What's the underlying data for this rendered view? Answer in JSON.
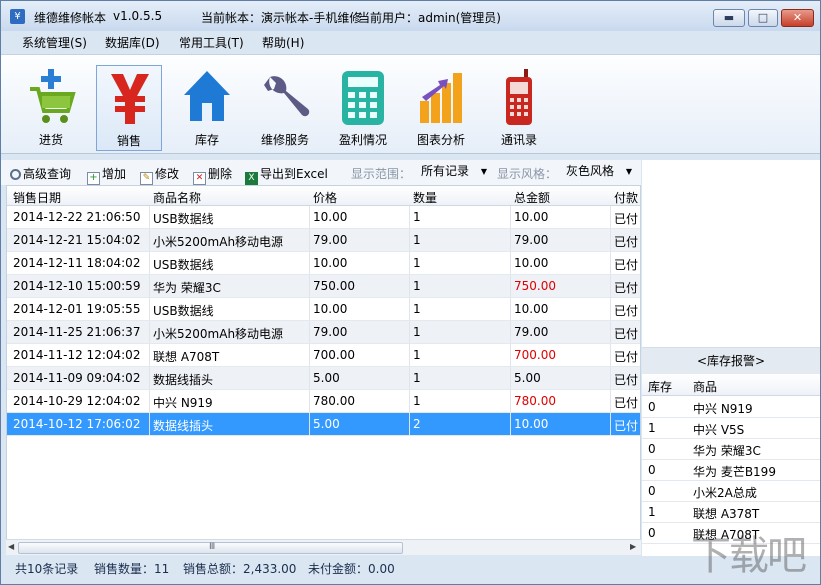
{
  "window": {
    "title": "维德维修帐本",
    "version": "v1.0.5.5",
    "account": "当前帐本：演示帐本-手机维修",
    "user": "当前用户：admin(管理员)",
    "app_icon": "¥",
    "controls": {
      "minimize": "▬",
      "maximize": "□",
      "close": "✕"
    }
  },
  "menu": [
    "系统管理(S)",
    "数据库(D)",
    "常用工具(T)",
    "帮助(H)"
  ],
  "toolbar": [
    {
      "label": "进货",
      "icon": "cart-icon",
      "active": false
    },
    {
      "label": "销售",
      "icon": "yen-icon",
      "active": true
    },
    {
      "label": "库存",
      "icon": "house-icon",
      "active": false
    },
    {
      "label": "维修服务",
      "icon": "wrench-icon",
      "active": false
    },
    {
      "label": "盈利情况",
      "icon": "calculator-icon",
      "active": false
    },
    {
      "label": "图表分析",
      "icon": "bar-chart-icon",
      "active": false
    },
    {
      "label": "通讯录",
      "icon": "phone-icon",
      "active": false
    }
  ],
  "querybar": {
    "search": "高级查询",
    "add": "增加",
    "edit": "修改",
    "delete": "删除",
    "export": "导出到Excel",
    "range_label": "显示范围：",
    "range_value": "所有记录",
    "style_label": "显示风格：",
    "style_value": "灰色风格"
  },
  "grid": {
    "headers": [
      "销售日期",
      "商品名称",
      "价格",
      "数量",
      "总金额",
      "付款"
    ],
    "rows": [
      {
        "date": "2014-12-22 21:06:50",
        "name": "USB数据线",
        "price": "10.00",
        "qty": "1",
        "total": "10.00",
        "pay": "已付",
        "red": false
      },
      {
        "date": "2014-12-21 15:04:02",
        "name": "小米5200mAh移动电源",
        "price": "79.00",
        "qty": "1",
        "total": "79.00",
        "pay": "已付",
        "red": false
      },
      {
        "date": "2014-12-11 18:04:02",
        "name": "USB数据线",
        "price": "10.00",
        "qty": "1",
        "total": "10.00",
        "pay": "已付",
        "red": false
      },
      {
        "date": "2014-12-10 15:00:59",
        "name": "华为 荣耀3C",
        "price": "750.00",
        "qty": "1",
        "total": "750.00",
        "pay": "已付",
        "red": true
      },
      {
        "date": "2014-12-01 19:05:55",
        "name": "USB数据线",
        "price": "10.00",
        "qty": "1",
        "total": "10.00",
        "pay": "已付",
        "red": false
      },
      {
        "date": "2014-11-25 21:06:37",
        "name": "小米5200mAh移动电源",
        "price": "79.00",
        "qty": "1",
        "total": "79.00",
        "pay": "已付",
        "red": false
      },
      {
        "date": "2014-11-12 12:04:02",
        "name": "联想 A708T",
        "price": "700.00",
        "qty": "1",
        "total": "700.00",
        "pay": "已付",
        "red": true
      },
      {
        "date": "2014-11-09 09:04:02",
        "name": "数据线插头",
        "price": "5.00",
        "qty": "1",
        "total": "5.00",
        "pay": "已付",
        "red": false
      },
      {
        "date": "2014-10-29 12:04:02",
        "name": "中兴 N919",
        "price": "780.00",
        "qty": "1",
        "total": "780.00",
        "pay": "已付",
        "red": true
      },
      {
        "date": "2014-10-12 17:06:02",
        "name": "数据线插头",
        "price": "5.00",
        "qty": "2",
        "total": "10.00",
        "pay": "已付",
        "red": false,
        "selected": true
      }
    ],
    "hscroll_grip": "Ⅲ"
  },
  "status": {
    "count": "共10条记录",
    "sales_qty": "销售数量：11",
    "sales_total": "销售总额：2,433.00",
    "unpaid": "未付金额：0.00"
  },
  "stock_alert": {
    "title": "<库存报警>",
    "headers": [
      "库存",
      "商品"
    ],
    "rows": [
      {
        "qty": "0",
        "name": "中兴 N919"
      },
      {
        "qty": "1",
        "name": "中兴 V5S"
      },
      {
        "qty": "0",
        "name": "华为 荣耀3C"
      },
      {
        "qty": "0",
        "name": "华为 麦芒B199"
      },
      {
        "qty": "0",
        "name": "小米2A总成"
      },
      {
        "qty": "1",
        "name": "联想 A378T"
      },
      {
        "qty": "0",
        "name": "联想 A708T"
      }
    ]
  },
  "watermark": "下载吧",
  "colors": {
    "selected_row": "#3399ff",
    "red_amount": "#e00000",
    "titlebar": "#c9d9ee"
  }
}
